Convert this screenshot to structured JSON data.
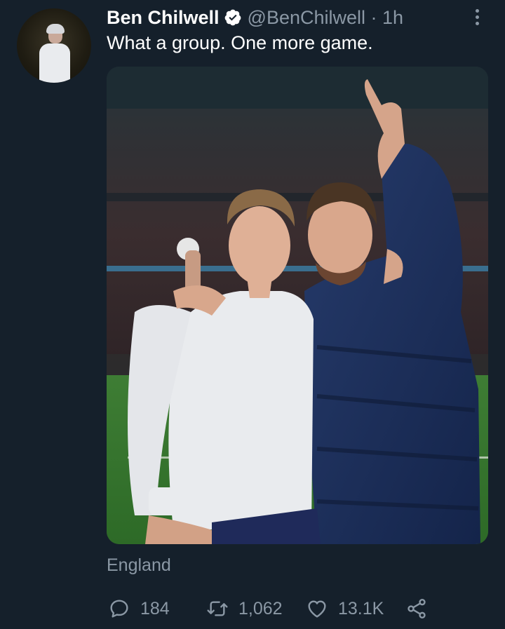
{
  "tweet": {
    "display_name": "Ben Chilwell",
    "handle_time": "@BenChilwell · 1h",
    "text": "What a group. One more game.",
    "location": "England",
    "media": {
      "description": "Two England players celebrating on the pitch in a stadium at night",
      "alt": "Tweet photo"
    }
  },
  "actions": {
    "replies": "184",
    "retweets": "1,062",
    "likes": "13.1K"
  },
  "icons": {
    "verified": "verified-badge-icon",
    "more": "more-vertical-icon",
    "reply": "reply-icon",
    "retweet": "retweet-icon",
    "like": "heart-icon",
    "share": "share-icon"
  },
  "colors": {
    "background": "#15202b",
    "secondary_text": "#8b98a5",
    "primary_text": "#ffffff"
  }
}
